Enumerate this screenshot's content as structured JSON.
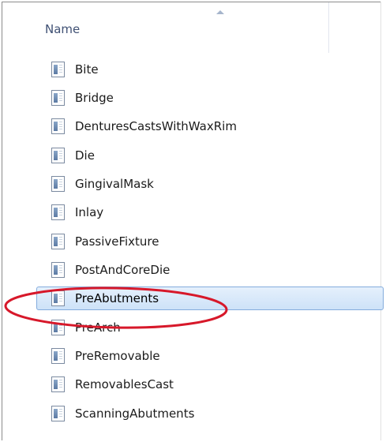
{
  "header": {
    "name_column": "Name",
    "sort_icon": "sort-ascending-icon"
  },
  "files": [
    {
      "name": "Bite",
      "icon": "document-icon",
      "selected": false
    },
    {
      "name": "Bridge",
      "icon": "document-icon",
      "selected": false
    },
    {
      "name": "DenturesCastsWithWaxRim",
      "icon": "document-icon",
      "selected": false
    },
    {
      "name": "Die",
      "icon": "document-icon",
      "selected": false
    },
    {
      "name": "GingivalMask",
      "icon": "document-icon",
      "selected": false
    },
    {
      "name": "Inlay",
      "icon": "document-icon",
      "selected": false
    },
    {
      "name": "PassiveFixture",
      "icon": "document-icon",
      "selected": false
    },
    {
      "name": "PostAndCoreDie",
      "icon": "document-icon",
      "selected": false
    },
    {
      "name": "PreAbutments",
      "icon": "document-icon",
      "selected": true
    },
    {
      "name": "PreArch",
      "icon": "document-icon",
      "selected": false
    },
    {
      "name": "PreRemovable",
      "icon": "document-icon",
      "selected": false
    },
    {
      "name": "RemovablesCast",
      "icon": "document-icon",
      "selected": false
    },
    {
      "name": "ScanningAbutments",
      "icon": "document-icon",
      "selected": false
    }
  ],
  "colors": {
    "annotation": "#d7182a",
    "selection": "#cde2f8",
    "header_text": "#405174"
  }
}
